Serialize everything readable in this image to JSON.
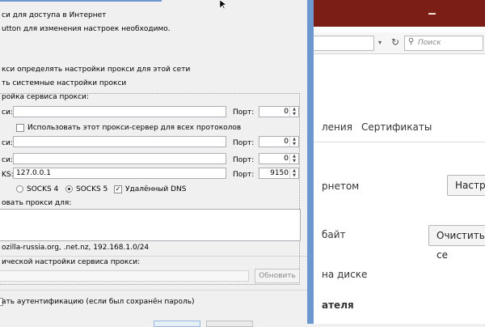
{
  "background_window": {
    "search_placeholder": "Поиск",
    "tabs": [
      "ления",
      "Сертификаты"
    ],
    "rows": [
      {
        "text": "рнетом",
        "button": "Настро"
      },
      {
        "text": "байт",
        "button": "Очистить се"
      },
      {
        "text": "на диске"
      },
      {
        "text": "ателя"
      }
    ],
    "colors": {
      "titlebar": "#7a1e16"
    }
  },
  "dialog": {
    "heading": "си для доступа в Интернет",
    "hint": "utton для изменения настроек необходимо.",
    "options": [
      {
        "label": "кси определять настройки прокси для этой сети"
      },
      {
        "label": "ть системные настройки прокси"
      },
      {
        "label": "ройка сервиса прокси:"
      }
    ],
    "manual": {
      "rows": [
        {
          "label": "си:",
          "value": "",
          "port_label": "Порт:",
          "port": "0"
        },
        {
          "label": "си:",
          "value": "",
          "port_label": "Порт:",
          "port": "0"
        },
        {
          "label": "си:",
          "value": "",
          "port_label": "Порт:",
          "port": "0"
        },
        {
          "label": "KS:",
          "value": "127.0.0.1",
          "port_label": "Порт:",
          "port": "9150"
        }
      ],
      "use_for_all_label": "Использовать этот прокси-сервер для всех протоколов",
      "socks4_label": "SOCKS 4",
      "socks5_label": "SOCKS 5",
      "remote_dns_label": "Удалённый DNS",
      "no_proxy_label": "овать прокси для:",
      "no_proxy_example": "ozilla-russia.org, .net.nz, 192.168.1.0/24"
    },
    "auto_label": "ической настройки сервиса прокси:",
    "refresh_label": "Обновить",
    "auth_label": "ать аутентификацию (если был сохранён пароль)"
  }
}
